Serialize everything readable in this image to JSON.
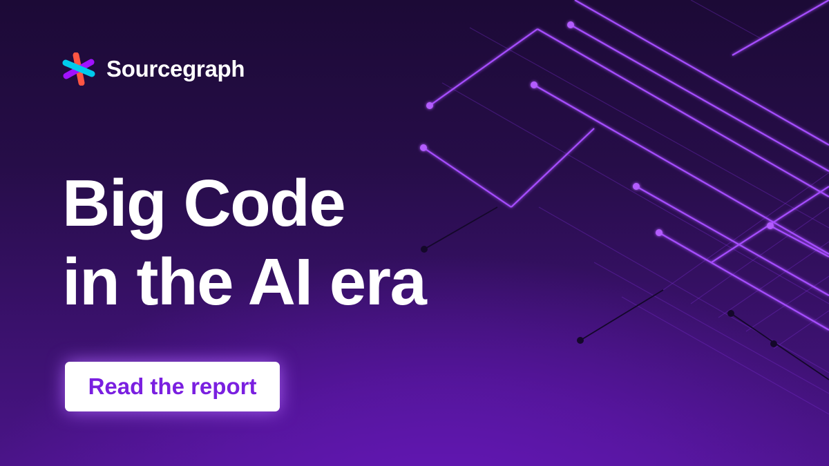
{
  "brand": {
    "name": "Sourcegraph",
    "icon": "sourcegraph-logo-icon",
    "colors": [
      "#ff5543",
      "#a112ff",
      "#00cbec"
    ]
  },
  "headline": {
    "line1": "Big Code",
    "line2": "in the AI era"
  },
  "cta": {
    "label": "Read the report",
    "text_color": "#7a1fe0"
  },
  "theme": {
    "background_dark": "#1c0a36",
    "background_glow": "#6517b8",
    "line_color": "#a64dff",
    "dark_node_color": "#14082a"
  }
}
